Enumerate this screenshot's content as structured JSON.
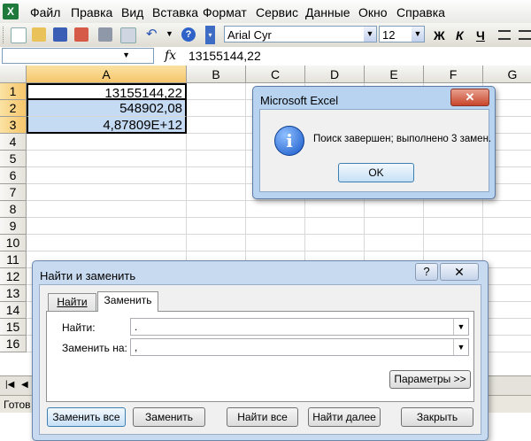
{
  "menu": {
    "logo": "X",
    "items": [
      "Файл",
      "Правка",
      "Вид",
      "Вставка",
      "Формат",
      "Сервис",
      "Данные",
      "Окно",
      "Справка"
    ]
  },
  "toolbar": {
    "font_name": "Arial Cyr",
    "font_size": "12",
    "bold": "Ж",
    "italic": "К",
    "underline": "Ч",
    "icons": [
      "new-document-icon",
      "open-folder-icon",
      "save-icon",
      "permission-icon",
      "print-icon",
      "print-preview-icon",
      "undo-icon",
      "help-icon"
    ]
  },
  "formula_bar": {
    "name_box": "",
    "fx": "fx",
    "value": "13155144,22"
  },
  "grid": {
    "columns": [
      "A",
      "B",
      "C",
      "D",
      "E",
      "F",
      "G"
    ],
    "rows": [
      "1",
      "2",
      "3",
      "4",
      "5",
      "6",
      "7",
      "8",
      "9",
      "10",
      "11",
      "12",
      "13",
      "14",
      "15",
      "16"
    ],
    "cells": {
      "A1": "13155144,22",
      "A2": "548902,08",
      "A3": "4,87809E+12"
    }
  },
  "statusbar": {
    "text": "Готов"
  },
  "message_box": {
    "title": "Microsoft Excel",
    "close_label": "✕",
    "icon_glyph": "i",
    "message": "Поиск завершен; выполнено 3 замен.",
    "ok_label": "OK"
  },
  "find_replace": {
    "title": "Найти и заменить",
    "help_label": "?",
    "close_label": "✕",
    "tabs": [
      {
        "label": "Найти",
        "active": false
      },
      {
        "label": "Заменить",
        "active": true
      }
    ],
    "find_label": "Найти:",
    "find_value": ".",
    "replace_label": "Заменить на:",
    "replace_value": ",",
    "options_label": "Параметры >>",
    "buttons": {
      "replace_all": "Заменить все",
      "replace": "Заменить",
      "find_all": "Найти все",
      "find_next": "Найти далее",
      "close": "Закрыть"
    }
  },
  "colors": {
    "selection": "#c5daf3",
    "dialog_frame": "#c8daf0",
    "close_button": "#c7452b",
    "excel_green": "#1d7a3a"
  }
}
